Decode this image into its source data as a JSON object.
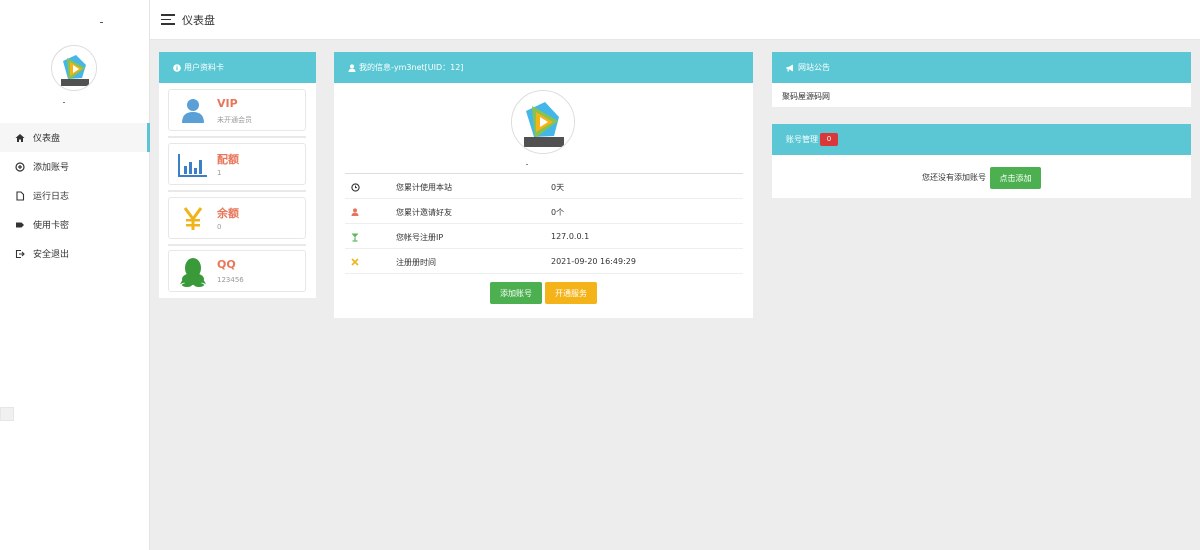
{
  "header": {
    "title": "仪表盘"
  },
  "sidebar": {
    "items": [
      {
        "label": "仪表盘",
        "icon": "home-icon",
        "active": true
      },
      {
        "label": "添加账号",
        "icon": "add-circle-icon",
        "active": false
      },
      {
        "label": "运行日志",
        "icon": "file-icon",
        "active": false
      },
      {
        "label": "使用卡密",
        "icon": "tag-icon",
        "active": false
      },
      {
        "label": "安全退出",
        "icon": "logout-icon",
        "active": false
      }
    ]
  },
  "profile_card": {
    "title": "用户资料卡",
    "cards": [
      {
        "label": "VIP",
        "value": "未开通会员",
        "icon": "user-icon",
        "icon_color": "#5a9fd6"
      },
      {
        "label": "配额",
        "value": "1",
        "icon": "bar-chart-icon",
        "icon_color": "#3a7fc8"
      },
      {
        "label": "余额",
        "value": "0",
        "icon": "yen-icon",
        "icon_color": "#f0b41a"
      },
      {
        "label": "QQ",
        "value": "123456",
        "icon": "qq-icon",
        "icon_color": "#3a9a3a"
      }
    ]
  },
  "my_info": {
    "title": "我的信息-ym3net[UID：12]",
    "rows": [
      {
        "label": "您累计使用本站",
        "value": "0天",
        "icon": "clock-icon",
        "icon_color": "#333333"
      },
      {
        "label": "您累计邀请好友",
        "value": "0个",
        "icon": "user-icon",
        "icon_color": "#e8765a"
      },
      {
        "label": "您帐号注册IP",
        "value": "127.0.0.1",
        "icon": "glass-icon",
        "icon_color": "#5cb85c"
      },
      {
        "label": "注册册时间",
        "value": "2021-09-20 16:49:29",
        "icon": "close-icon",
        "icon_color": "#f0b41a"
      }
    ],
    "add_button": "添加账号",
    "service_button": "开通服务"
  },
  "announcement": {
    "title": "网站公告",
    "content": "聚码屋源码网"
  },
  "account_manage": {
    "title": "账号管理",
    "badge": "0",
    "empty_text": "您还没有添加账号",
    "add_button": "点击添加"
  },
  "colors": {
    "accent": "#5bc7d4",
    "green": "#4caf50",
    "orange": "#f5b31a",
    "label_red": "#e8765a"
  }
}
